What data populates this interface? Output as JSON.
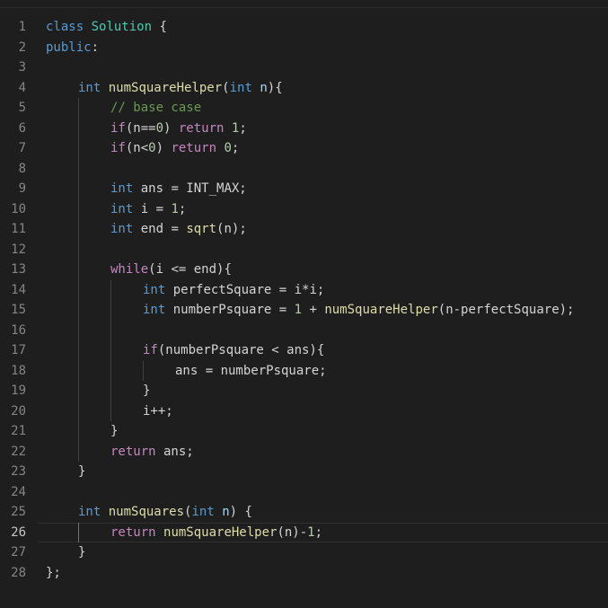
{
  "editor": {
    "theme": {
      "background": "#1e1e1e",
      "keyword": "#569cd6",
      "control": "#c586c0",
      "function": "#dcdcaa",
      "type": "#4ec9b0",
      "number": "#b5cea8",
      "comment": "#6a9955",
      "text": "#d4d4d4"
    },
    "current_line": 26,
    "lines": [
      {
        "n": "1",
        "indent": 0,
        "tokens": [
          [
            "kw",
            "class"
          ],
          [
            "pl",
            " "
          ],
          [
            "typ",
            "Solution"
          ],
          [
            "pl",
            " {"
          ]
        ]
      },
      {
        "n": "2",
        "indent": 0,
        "tokens": [
          [
            "kw",
            "public"
          ],
          [
            "pl",
            ":"
          ]
        ]
      },
      {
        "n": "3",
        "indent": 0,
        "tokens": []
      },
      {
        "n": "4",
        "indent": 1,
        "tokens": [
          [
            "kw",
            "int"
          ],
          [
            "pl",
            " "
          ],
          [
            "fn",
            "numSquareHelper"
          ],
          [
            "pl",
            "("
          ],
          [
            "kw",
            "int"
          ],
          [
            "pl",
            " "
          ],
          [
            "var",
            "n"
          ],
          [
            "pl",
            "){"
          ]
        ]
      },
      {
        "n": "5",
        "indent": 2,
        "tokens": [
          [
            "cm",
            "// base case"
          ]
        ]
      },
      {
        "n": "6",
        "indent": 2,
        "tokens": [
          [
            "ctl",
            "if"
          ],
          [
            "pl",
            "(n=="
          ],
          [
            "num",
            "0"
          ],
          [
            "pl",
            ") "
          ],
          [
            "ctl",
            "return"
          ],
          [
            "pl",
            " "
          ],
          [
            "num",
            "1"
          ],
          [
            "pl",
            ";"
          ]
        ]
      },
      {
        "n": "7",
        "indent": 2,
        "tokens": [
          [
            "ctl",
            "if"
          ],
          [
            "pl",
            "(n<"
          ],
          [
            "num",
            "0"
          ],
          [
            "pl",
            ") "
          ],
          [
            "ctl",
            "return"
          ],
          [
            "pl",
            " "
          ],
          [
            "num",
            "0"
          ],
          [
            "pl",
            ";"
          ]
        ]
      },
      {
        "n": "8",
        "indent": 0,
        "tokens": []
      },
      {
        "n": "9",
        "indent": 2,
        "tokens": [
          [
            "kw",
            "int"
          ],
          [
            "pl",
            " ans = INT_MAX;"
          ]
        ]
      },
      {
        "n": "10",
        "indent": 2,
        "tokens": [
          [
            "kw",
            "int"
          ],
          [
            "pl",
            " i = "
          ],
          [
            "num",
            "1"
          ],
          [
            "pl",
            ";"
          ]
        ]
      },
      {
        "n": "11",
        "indent": 2,
        "tokens": [
          [
            "kw",
            "int"
          ],
          [
            "pl",
            " end = "
          ],
          [
            "fn",
            "sqrt"
          ],
          [
            "pl",
            "(n);"
          ]
        ]
      },
      {
        "n": "12",
        "indent": 0,
        "tokens": []
      },
      {
        "n": "13",
        "indent": 2,
        "tokens": [
          [
            "ctl",
            "while"
          ],
          [
            "pl",
            "(i <= end){"
          ]
        ]
      },
      {
        "n": "14",
        "indent": 3,
        "tokens": [
          [
            "kw",
            "int"
          ],
          [
            "pl",
            " perfectSquare = i*i;"
          ]
        ]
      },
      {
        "n": "15",
        "indent": 3,
        "tokens": [
          [
            "kw",
            "int"
          ],
          [
            "pl",
            " numberPsquare = "
          ],
          [
            "num",
            "1"
          ],
          [
            "pl",
            " + "
          ],
          [
            "fn",
            "numSquareHelper"
          ],
          [
            "pl",
            "(n-perfectSquare);"
          ]
        ]
      },
      {
        "n": "16",
        "indent": 0,
        "tokens": []
      },
      {
        "n": "17",
        "indent": 3,
        "tokens": [
          [
            "ctl",
            "if"
          ],
          [
            "pl",
            "(numberPsquare < ans){"
          ]
        ]
      },
      {
        "n": "18",
        "indent": 4,
        "tokens": [
          [
            "pl",
            "ans = numberPsquare;"
          ]
        ]
      },
      {
        "n": "19",
        "indent": 3,
        "tokens": [
          [
            "pl",
            "}"
          ]
        ]
      },
      {
        "n": "20",
        "indent": 3,
        "tokens": [
          [
            "pl",
            "i++;"
          ]
        ]
      },
      {
        "n": "21",
        "indent": 2,
        "tokens": [
          [
            "pl",
            "}"
          ]
        ]
      },
      {
        "n": "22",
        "indent": 2,
        "tokens": [
          [
            "ctl",
            "return"
          ],
          [
            "pl",
            " ans;"
          ]
        ]
      },
      {
        "n": "23",
        "indent": 1,
        "tokens": [
          [
            "pl",
            "}"
          ]
        ]
      },
      {
        "n": "24",
        "indent": 0,
        "tokens": []
      },
      {
        "n": "25",
        "indent": 1,
        "tokens": [
          [
            "kw",
            "int"
          ],
          [
            "pl",
            " "
          ],
          [
            "fn",
            "numSquares"
          ],
          [
            "pl",
            "("
          ],
          [
            "kw",
            "int"
          ],
          [
            "pl",
            " "
          ],
          [
            "var",
            "n"
          ],
          [
            "pl",
            ") {"
          ]
        ]
      },
      {
        "n": "26",
        "indent": 2,
        "tokens": [
          [
            "ctl",
            "return"
          ],
          [
            "pl",
            " "
          ],
          [
            "fn",
            "numSquareHelper"
          ],
          [
            "pl",
            "(n)-"
          ],
          [
            "num",
            "1"
          ],
          [
            "pl",
            ";"
          ]
        ]
      },
      {
        "n": "27",
        "indent": 1,
        "tokens": [
          [
            "pl",
            "}"
          ]
        ]
      },
      {
        "n": "28",
        "indent": 0,
        "tokens": [
          [
            "pl",
            "};"
          ]
        ]
      }
    ]
  }
}
